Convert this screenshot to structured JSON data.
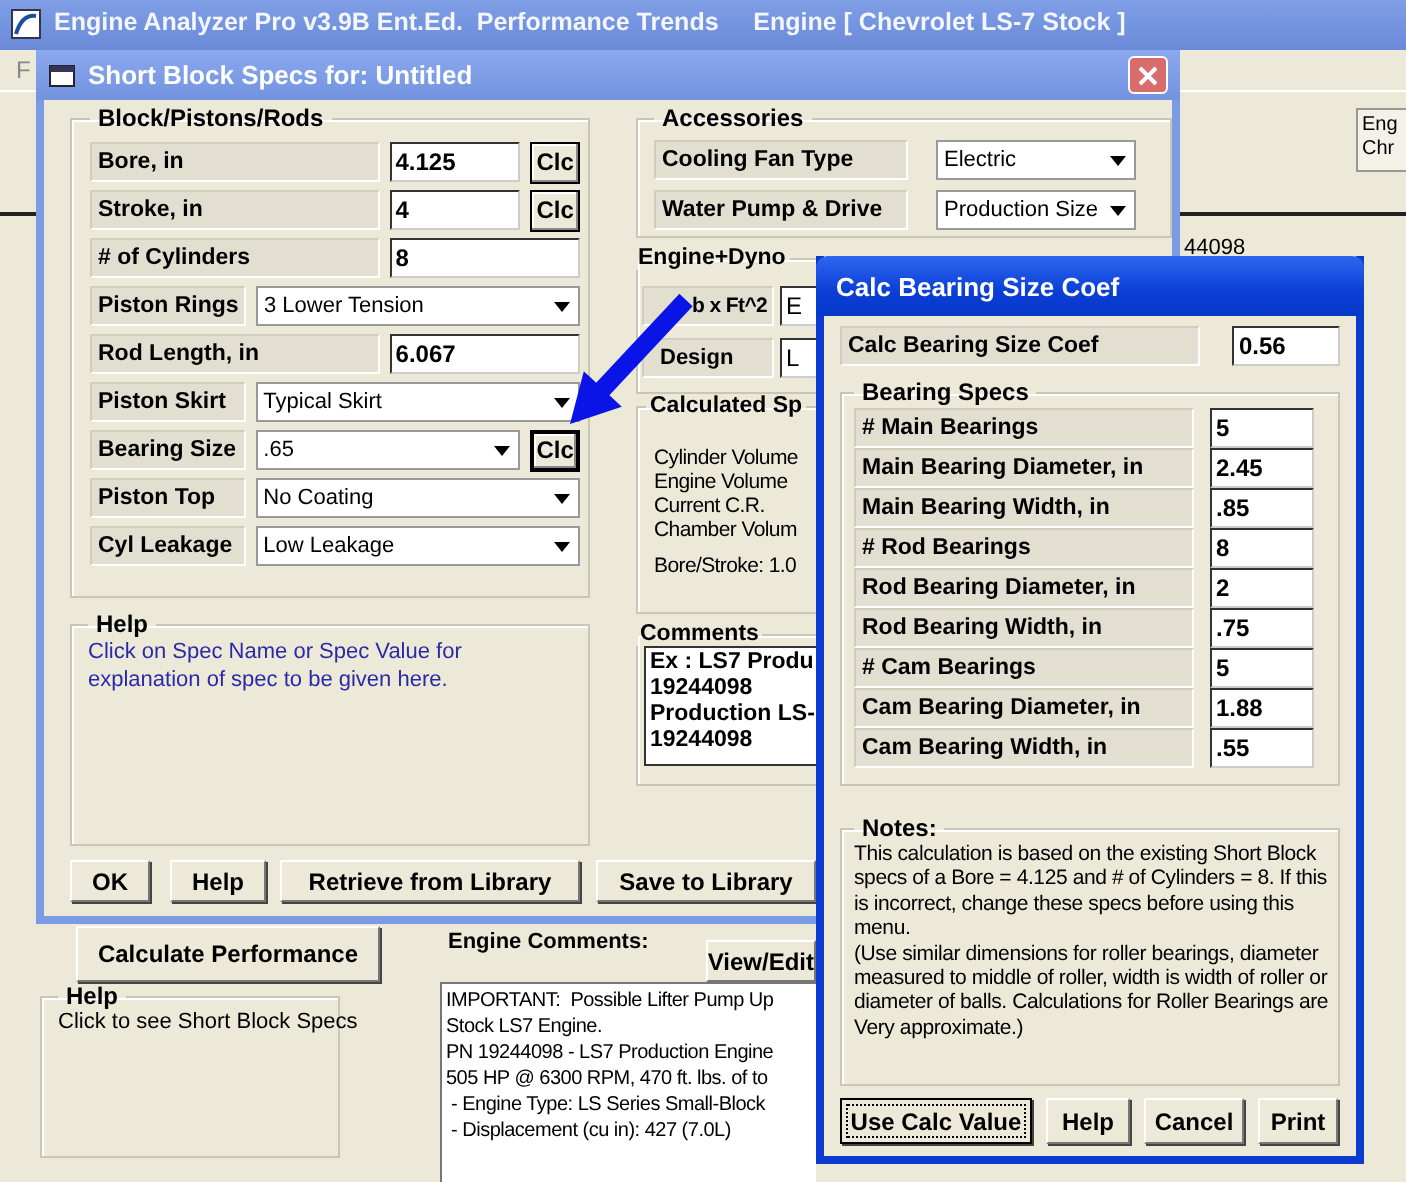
{
  "app": {
    "title": "Engine Analyzer Pro v3.9B Ent.Ed.  Performance Trends     Engine [ Chevrolet LS-7 Stock ]",
    "menu": [
      "F"
    ],
    "side_box": [
      "Eng",
      "Chr"
    ],
    "part_number": "44098",
    "calc_button": "Calculate Performance",
    "help": {
      "title": "Help",
      "text": "Click to see Short Block Specs"
    },
    "comments_label": "Engine Comments:",
    "view_button": "View/Edit",
    "comment_lines": [
      "IMPORTANT:  Possible Lifter Pump Up",
      "Stock LS7 Engine.",
      "PN 19244098 - LS7 Production Engine",
      "505 HP @ 6300 RPM, 470 ft. lbs. of to",
      " - Engine Type: LS Series Small-Block",
      " - Displacement (cu in): 427 (7.0L)"
    ]
  },
  "short_block": {
    "title": "Short Block Specs for: Untitled",
    "block_group": "Block/Pistons/Rods",
    "block_rows": [
      {
        "label": "Bore, in",
        "kind": "number_calc",
        "value": "4.125",
        "button": "Clc"
      },
      {
        "label": "Stroke, in",
        "kind": "number_calc",
        "value": "4",
        "button": "Clc"
      },
      {
        "label": "# of Cylinders",
        "kind": "number",
        "value": "8"
      },
      {
        "label": "Piston Rings",
        "kind": "choice",
        "value": "3 Lower Tension"
      },
      {
        "label": "Rod Length, in",
        "kind": "number",
        "value": "6.067"
      },
      {
        "label": "Piston Skirt",
        "kind": "choice",
        "value": "Typical Skirt"
      },
      {
        "label": "Bearing Size",
        "kind": "choice_calc",
        "value": ".65",
        "button": "Clc"
      },
      {
        "label": "Piston Top",
        "kind": "choice",
        "value": "No Coating"
      },
      {
        "label": "Cyl Leakage",
        "kind": "choice",
        "value": "Low Leakage"
      }
    ],
    "accessories": {
      "title": "Accessories",
      "rows": [
        {
          "label": "Cooling Fan Type",
          "value": "Electric"
        },
        {
          "label": "Water Pump & Drive",
          "value": "Production Size"
        }
      ]
    },
    "dyno": {
      "title": "Engine+Dyno",
      "rows": [
        {
          "label": "b x Ft^2",
          "value": "E"
        },
        {
          "label": "Design",
          "value": "L"
        }
      ]
    },
    "calculated": {
      "title": "Calculated Sp",
      "lines": [
        "Cylinder Volume",
        "Engine Volume",
        "Current C.R.",
        "Chamber Volum"
      ],
      "ratio": "Bore/Stroke: 1.0"
    },
    "comments": {
      "title": "Comments",
      "lines": [
        "Ex : LS7 Produ",
        "19244098",
        "Production LS-",
        "19244098"
      ]
    },
    "help": {
      "title": "Help",
      "text": "Click on Spec Name or Spec Value for explanation of spec to be given here."
    },
    "buttons": [
      "OK",
      "Help",
      "Retrieve from Library",
      "Save to Library"
    ]
  },
  "calc_window": {
    "title": "Calc Bearing Size Coef",
    "result": {
      "label": "Calc Bearing Size Coef",
      "value": "0.56"
    },
    "group": "Bearing Specs",
    "rows": [
      {
        "label": "# Main Bearings",
        "value": "5"
      },
      {
        "label": "Main Bearing Diameter, in",
        "value": "2.45"
      },
      {
        "label": "Main Bearing Width, in",
        "value": ".85"
      },
      {
        "label": "# Rod Bearings",
        "value": "8"
      },
      {
        "label": "Rod Bearing Diameter, in",
        "value": "2"
      },
      {
        "label": "Rod Bearing Width, in",
        "value": ".75"
      },
      {
        "label": "# Cam Bearings",
        "value": "5"
      },
      {
        "label": "Cam Bearing Diameter, in",
        "value": "1.88"
      },
      {
        "label": "Cam Bearing Width, in",
        "value": ".55"
      }
    ],
    "notes_title": "Notes:",
    "notes": "This calculation is based on the existing Short Block specs of a Bore =  4.125 and # of Cylinders = 8.  If this is incorrect, change these specs before using this menu.\n(Use similar dimensions for roller bearings, diameter measured to middle of roller, width is width of roller or diameter of balls.  Calculations for Roller Bearings are Very approximate.)",
    "buttons": [
      {
        "label": "Use Calc Value",
        "focused": true
      },
      {
        "label": "Help",
        "focused": false
      },
      {
        "label": "Cancel",
        "focused": false
      },
      {
        "label": "Print",
        "focused": false
      }
    ]
  }
}
